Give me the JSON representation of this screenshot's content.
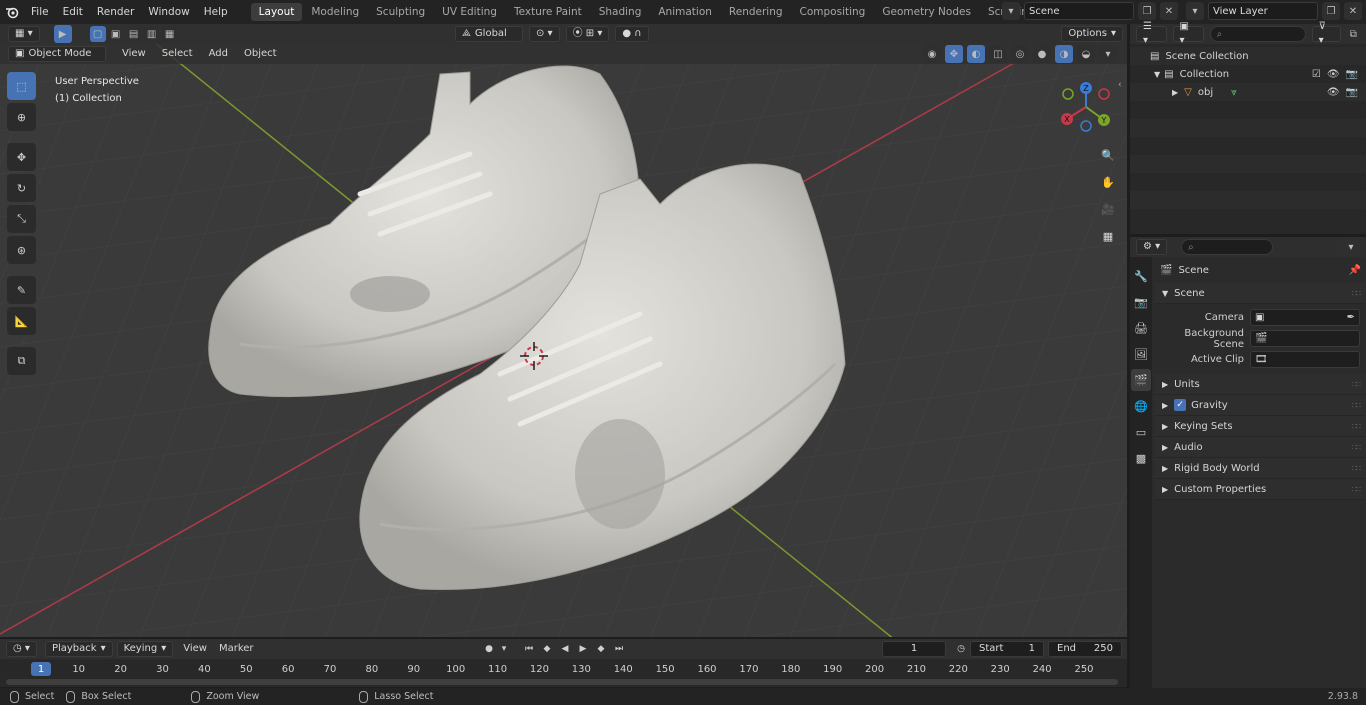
{
  "topbar": {
    "menus": [
      "File",
      "Edit",
      "Render",
      "Window",
      "Help"
    ],
    "workspaces": [
      "Layout",
      "Modeling",
      "Sculpting",
      "UV Editing",
      "Texture Paint",
      "Shading",
      "Animation",
      "Rendering",
      "Compositing",
      "Geometry Nodes",
      "Scripting"
    ],
    "active_workspace": "Layout",
    "add_tab": "+",
    "scene_name": "Scene",
    "view_layer": "View Layer"
  },
  "viewport": {
    "mode": "Object Mode",
    "header_menus": [
      "View",
      "Select",
      "Add",
      "Object"
    ],
    "transform_orientation": "Global",
    "options_label": "Options",
    "overlay_title": "User Perspective",
    "overlay_collection": "(1) Collection",
    "gizmo": {
      "z": "Z",
      "y": "Y",
      "x": "X"
    }
  },
  "outliner": {
    "rows": [
      {
        "label": "Scene Collection"
      },
      {
        "label": "Collection"
      },
      {
        "label": "obj"
      }
    ]
  },
  "properties": {
    "context": "Scene",
    "panel_scene": "Scene",
    "fields": [
      {
        "label": "Camera"
      },
      {
        "label": "Background Scene"
      },
      {
        "label": "Active Clip"
      }
    ],
    "collapsed_panels": [
      "Units",
      "Gravity",
      "Keying Sets",
      "Audio",
      "Rigid Body World",
      "Custom Properties"
    ]
  },
  "timeline": {
    "menus": [
      "Playback",
      "Keying",
      "View",
      "Marker"
    ],
    "current_frame": "1",
    "start_label": "Start",
    "start_value": "1",
    "end_label": "End",
    "end_value": "250",
    "ruler": [
      "1",
      "10",
      "20",
      "30",
      "40",
      "50",
      "60",
      "70",
      "80",
      "90",
      "100",
      "110",
      "120",
      "130",
      "140",
      "150",
      "160",
      "170",
      "180",
      "190",
      "200",
      "210",
      "220",
      "230",
      "240",
      "250"
    ]
  },
  "statusbar": {
    "select": "Select",
    "box_select": "Box Select",
    "zoom_view": "Zoom View",
    "lasso_select": "Lasso Select",
    "version": "2.93.8"
  },
  "colors": {
    "accent": "#4772b3",
    "axis_x": "#c8384a",
    "axis_y": "#7aa42a",
    "axis_z": "#3b7bd6"
  }
}
